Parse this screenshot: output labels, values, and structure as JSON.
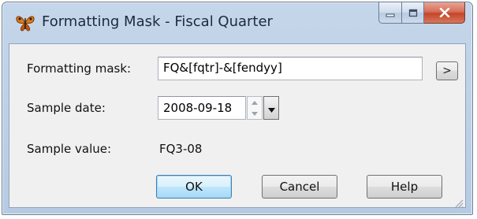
{
  "window": {
    "title": "Formatting Mask - Fiscal Quarter",
    "app_icon": "butterfly-icon",
    "caption_buttons": [
      "minimize-icon",
      "maximize-icon",
      "close-icon"
    ]
  },
  "form": {
    "mask_label": "Formatting mask:",
    "mask_value": "FQ&[fqtr]-&[fendyy]",
    "browse_button_label": ">",
    "date_label": "Sample date:",
    "date_value": "2008-09-18",
    "value_label": "Sample value:",
    "value_text": "FQ3-08"
  },
  "buttons": {
    "ok": "OK",
    "cancel": "Cancel",
    "help": "Help"
  },
  "colors": {
    "titlebar": "#c5d6ea",
    "close_button": "#c4452a",
    "default_button_border": "#3c7fb1"
  }
}
